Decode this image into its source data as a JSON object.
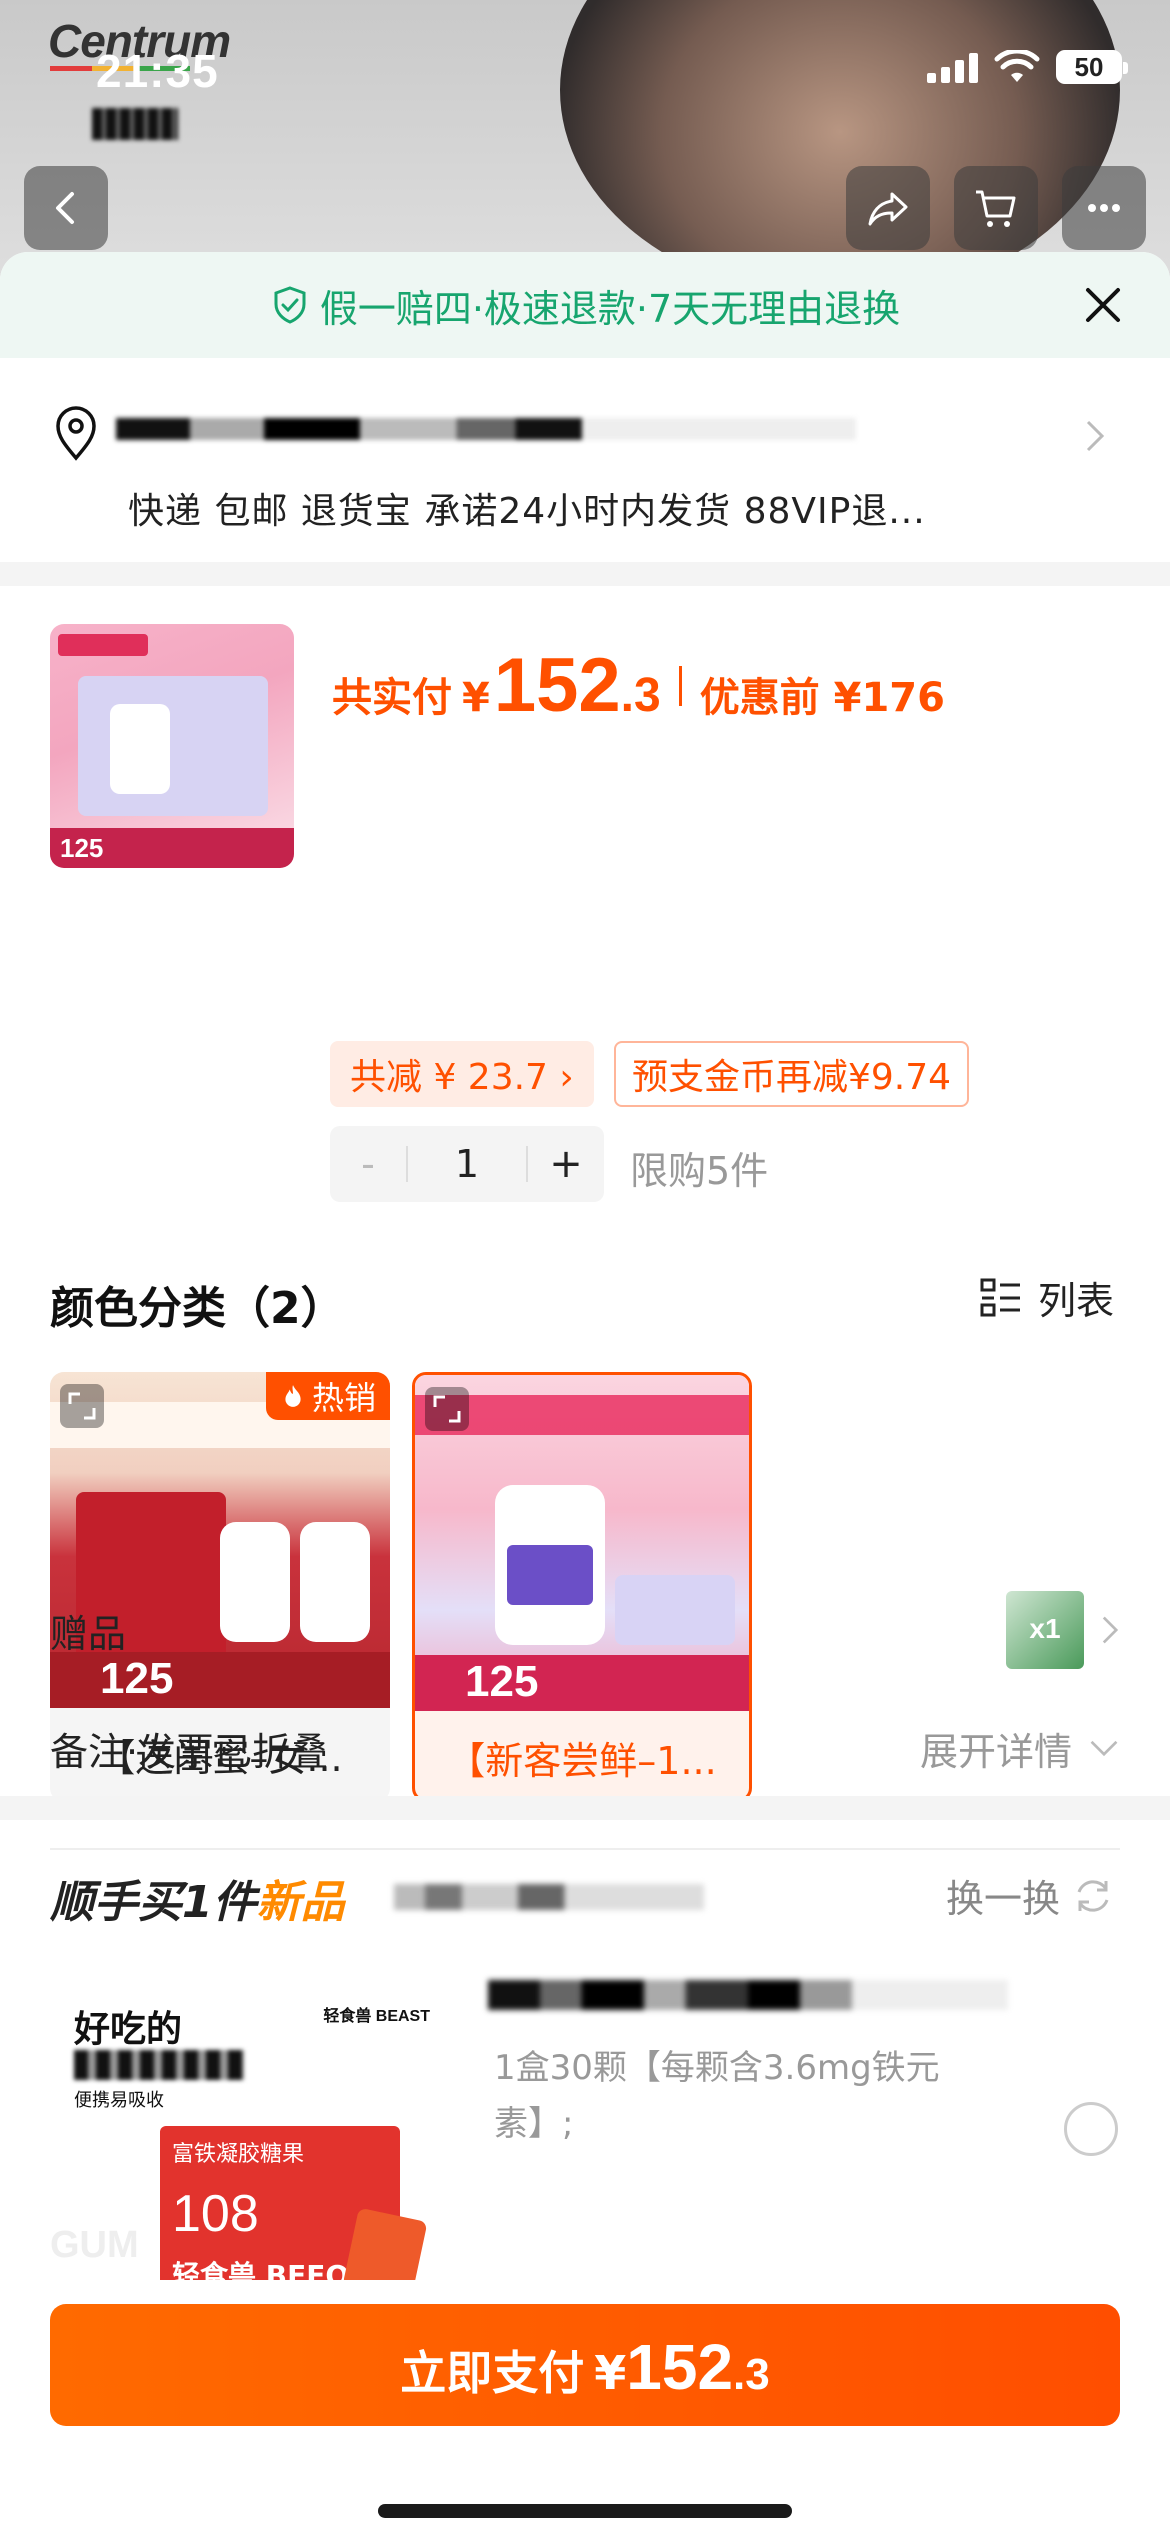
{
  "status_bar": {
    "time": "21:35",
    "battery": "50"
  },
  "header": {
    "brand": "Centrum"
  },
  "guarantee": {
    "text": "假一赔四·极速退款·7天无理由退换"
  },
  "address": {
    "services": "快递 包邮 退货宝 承诺24小时内发货 88VIP退..."
  },
  "product": {
    "thumb_price": "125",
    "total_label": "共实付",
    "currency": "¥",
    "price_int": "152",
    "price_dec": ".3",
    "original_price": "优惠前 ¥176",
    "discount_chip": "共减 ¥ 23.7 ›",
    "coin_chip": "预支金币再减¥9.74",
    "quantity": "1",
    "minus": "-",
    "plus": "+",
    "limit": "限购5件"
  },
  "variants": {
    "title": "颜色分类（2）",
    "view_toggle": "列表",
    "items": [
      {
        "label": "【送闺蜜–女...",
        "badge": "热销",
        "price": "125",
        "selected": false
      },
      {
        "label": "【新客尝鲜–1...",
        "price": "125",
        "selected": true
      }
    ]
  },
  "gift": {
    "label": "赠品",
    "thumb_text": "x1"
  },
  "notes": {
    "label": "备注·发票已折叠",
    "action": "展开详情"
  },
  "addon": {
    "title_prefix": "顺手买1件",
    "title_highlight": "新品",
    "swap": "换一换",
    "image_heading": "好吃的",
    "image_sub": "便携易吸收",
    "image_brand": "轻食兽 BEAST",
    "image_box_title": "富铁凝胶糖果",
    "image_box_number": "108",
    "image_box_brand": "轻食兽 BEEOK",
    "image_watermark": "GUM",
    "description": "1盒30颗【每颗含3.6mg铁元素】;"
  },
  "pay": {
    "label": "立即支付",
    "currency": "¥",
    "price_int": "152",
    "price_dec": ".3"
  },
  "colors": {
    "accent": "#ff5000",
    "green": "#17a56e"
  }
}
